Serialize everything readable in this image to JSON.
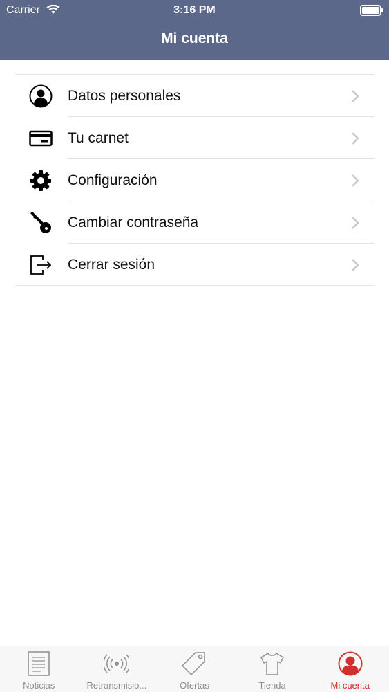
{
  "status_bar": {
    "carrier": "Carrier",
    "time": "3:16 PM",
    "wifi_icon": "wifi-icon",
    "battery_icon": "battery-icon"
  },
  "nav": {
    "title": "Mi cuenta"
  },
  "menu": {
    "items": [
      {
        "label": "Datos personales",
        "icon": "person-circle-icon"
      },
      {
        "label": "Tu carnet",
        "icon": "credit-card-icon"
      },
      {
        "label": "Configuración",
        "icon": "gear-icon"
      },
      {
        "label": "Cambiar contraseña",
        "icon": "key-icon"
      },
      {
        "label": "Cerrar sesión",
        "icon": "logout-icon"
      }
    ],
    "chevron_icon": "chevron-right-icon"
  },
  "tab_bar": {
    "tabs": [
      {
        "label": "Noticias",
        "icon": "newspaper-icon",
        "active": false
      },
      {
        "label": "Retransmisio...",
        "icon": "broadcast-icon",
        "active": false
      },
      {
        "label": "Ofertas",
        "icon": "tag-icon",
        "active": false
      },
      {
        "label": "Tienda",
        "icon": "tshirt-icon",
        "active": false
      },
      {
        "label": "Mi cuenta",
        "icon": "account-icon",
        "active": true
      }
    ],
    "active_color": "#d1302c",
    "inactive_color": "#8e8e93"
  },
  "colors": {
    "header_bg": "#5c6889",
    "separator": "#e3e3e3"
  }
}
